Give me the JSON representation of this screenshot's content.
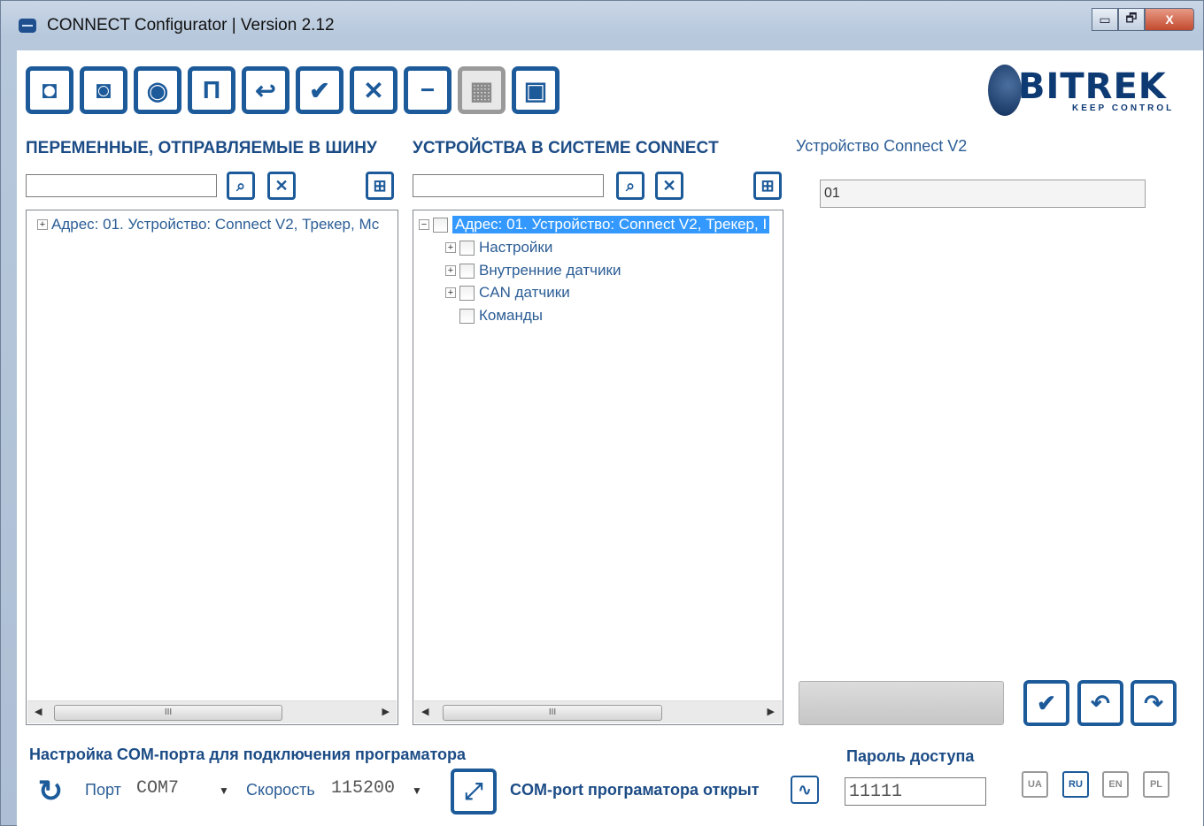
{
  "window": {
    "title": "CONNECT Configurator | Version 2.12",
    "minimize_glyph": "▭",
    "maximize_glyph": "🗗",
    "close_glyph": "X"
  },
  "toolbar": {
    "buttons": [
      {
        "icon": "read-config-icon",
        "glyph": "◘"
      },
      {
        "icon": "write-config-icon",
        "glyph": "◙"
      },
      {
        "icon": "view-icon",
        "glyph": "◉"
      },
      {
        "icon": "pause-icon",
        "glyph": "Π"
      },
      {
        "icon": "back-icon",
        "glyph": "↩"
      },
      {
        "icon": "check-icon",
        "glyph": "✔"
      },
      {
        "icon": "close-icon",
        "glyph": "✕"
      },
      {
        "icon": "minus-icon",
        "glyph": "−"
      },
      {
        "icon": "chip-icon",
        "glyph": "▦"
      },
      {
        "icon": "monitor-icon",
        "glyph": "▣"
      }
    ]
  },
  "logo": {
    "brand": "BITREK",
    "slogan": "KEEP CONTROL"
  },
  "left_panel": {
    "title": "ПЕРЕМЕННЫЕ, ОТПРАВЛЯЕМЫЕ В ШИНУ",
    "search_value": "",
    "tree": [
      {
        "text": "Адрес: 01. Устройство: Connect V2, Трекер, Мс",
        "expander": "+"
      }
    ],
    "scroll_grip": "III"
  },
  "middle_panel": {
    "title": "УСТРОЙСТВА В СИСТЕМЕ CONNECT",
    "search_value": "",
    "tree": [
      {
        "text": "Адрес: 01. Устройство: Connect V2, Трекер, I",
        "expander": "−",
        "selected": true
      },
      {
        "text": "Настройки",
        "expander": "+"
      },
      {
        "text": "Внутренние датчики",
        "expander": "+"
      },
      {
        "text": "CAN датчики",
        "expander": "+"
      },
      {
        "text": "Команды",
        "expander": ""
      }
    ],
    "scroll_grip": "III"
  },
  "right_panel": {
    "device_label": "Устройство Connect V2",
    "address_value": "01"
  },
  "bottom": {
    "com_title": "Настройка COM-порта для подключения програматора",
    "port_label": "Порт",
    "port_value": "COM7",
    "speed_label": "Скорость",
    "speed_value": "115200",
    "status_text": "COM-port програматора открыт",
    "password_label": "Пароль доступа",
    "password_value": "11111",
    "languages": [
      {
        "code": "UA",
        "active": false
      },
      {
        "code": "RU",
        "active": true
      },
      {
        "code": "EN",
        "active": false
      },
      {
        "code": "PL",
        "active": false
      }
    ]
  },
  "colors": {
    "accent": "#1c5a9a",
    "title_blue": "#1c4c86",
    "selection": "#3399ff"
  }
}
